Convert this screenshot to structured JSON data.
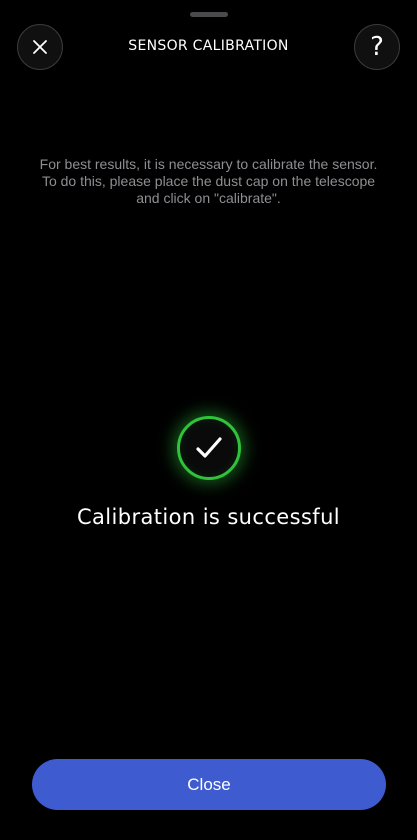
{
  "header": {
    "title": "SENSOR CALIBRATION",
    "close_icon": "close-icon",
    "help_icon": "question-mark-icon",
    "help_label": "?"
  },
  "instructions": {
    "line1": "For best results, it is necessary to calibrate the sensor.",
    "line2": "To do this, please place the dust cap on the telescope",
    "line3": "and click on \"calibrate\"."
  },
  "status": {
    "icon": "checkmark-icon",
    "message": "Calibration is successful",
    "color": "#2fc23a"
  },
  "footer": {
    "close_label": "Close",
    "button_color": "#3f5bd0"
  }
}
